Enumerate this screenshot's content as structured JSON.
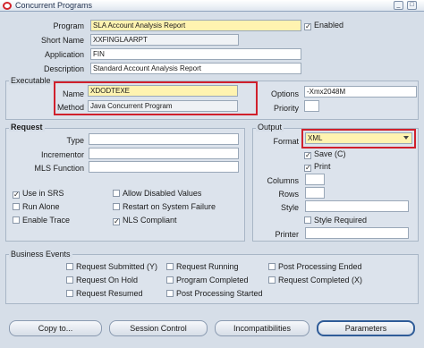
{
  "window": {
    "title": "Concurrent Programs",
    "icon": "oracle-logo-icon"
  },
  "program": {
    "program_label": "Program",
    "program_value": "SLA Account Analysis Report",
    "enabled_label": "Enabled",
    "short_name_label": "Short Name",
    "short_name_value": "XXFINGLAARPT",
    "application_label": "Application",
    "application_value": "FIN",
    "description_label": "Description",
    "description_value": "Standard Account Analysis Report"
  },
  "executable": {
    "section_label": "Executable",
    "name_label": "Name",
    "name_value": "XDODTEXE",
    "method_label": "Method",
    "method_value": "Java Concurrent Program",
    "options_label": "Options",
    "options_value": "-Xmx2048M",
    "priority_label": "Priority",
    "priority_value": ""
  },
  "request": {
    "section_label": "Request",
    "type_label": "Type",
    "incrementor_label": "Incrementor",
    "mls_label": "MLS Function",
    "use_in_srs": "Use in SRS",
    "allow_disabled": "Allow Disabled Values",
    "run_alone": "Run Alone",
    "restart": "Restart on System Failure",
    "enable_trace": "Enable Trace",
    "nls": "NLS Compliant"
  },
  "output": {
    "section_label": "Output",
    "format_label": "Format",
    "format_value": "XML",
    "save_label": "Save (C)",
    "print_label": "Print",
    "columns_label": "Columns",
    "rows_label": "Rows",
    "style_label": "Style",
    "style_required": "Style Required",
    "printer_label": "Printer"
  },
  "business_events": {
    "section_label": "Business Events",
    "items": [
      "Request Submitted (Y)",
      "Request Running",
      "Post Processing Ended",
      "Request On Hold",
      "Program Completed",
      "Request Completed (X)",
      "Request Resumed",
      "Post Processing Started"
    ]
  },
  "buttons": {
    "copy": "Copy to...",
    "session": "Session Control",
    "incompat": "Incompatibilities",
    "params": "Parameters"
  },
  "colors": {
    "highlight": "#d0202c",
    "required_field": "#fff3b0"
  }
}
